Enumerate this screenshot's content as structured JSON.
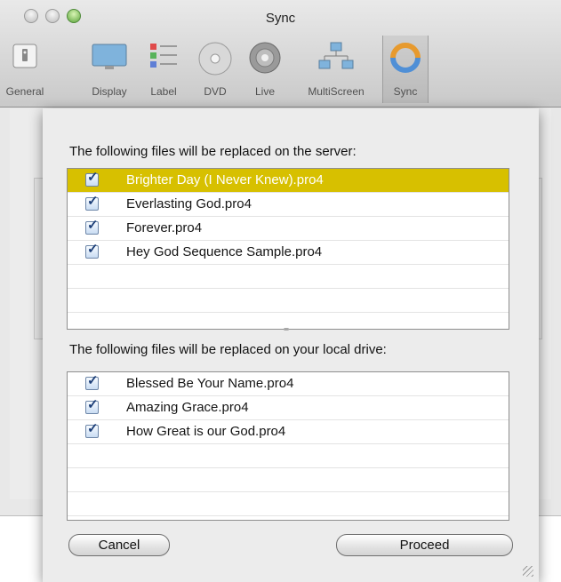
{
  "window": {
    "title": "Sync"
  },
  "toolbar": {
    "items": [
      {
        "label": "General",
        "icon": "general-icon"
      },
      {
        "label": "Display",
        "icon": "display-icon"
      },
      {
        "label": "Label",
        "icon": "label-icon"
      },
      {
        "label": "DVD",
        "icon": "dvd-icon"
      },
      {
        "label": "Live",
        "icon": "live-icon"
      },
      {
        "label": "MultiScreen",
        "icon": "multiscreen-icon"
      },
      {
        "label": "Sync",
        "icon": "sync-icon",
        "active": true
      }
    ]
  },
  "sheet": {
    "server_heading": "The following files will be replaced on the server:",
    "server_files": [
      {
        "name": "Brighter Day (I Never Knew).pro4",
        "checked": true,
        "selected": true
      },
      {
        "name": "Everlasting God.pro4",
        "checked": true
      },
      {
        "name": "Forever.pro4",
        "checked": true
      },
      {
        "name": "Hey God Sequence Sample.pro4",
        "checked": true
      }
    ],
    "local_heading": "The following files will be replaced on your local drive:",
    "local_files": [
      {
        "name": "Blessed Be Your Name.pro4",
        "checked": true
      },
      {
        "name": "Amazing Grace.pro4",
        "checked": true
      },
      {
        "name": "How Great is our God.pro4",
        "checked": true
      }
    ],
    "cancel_label": "Cancel",
    "proceed_label": "Proceed",
    "selection_color": "#d7c000"
  }
}
